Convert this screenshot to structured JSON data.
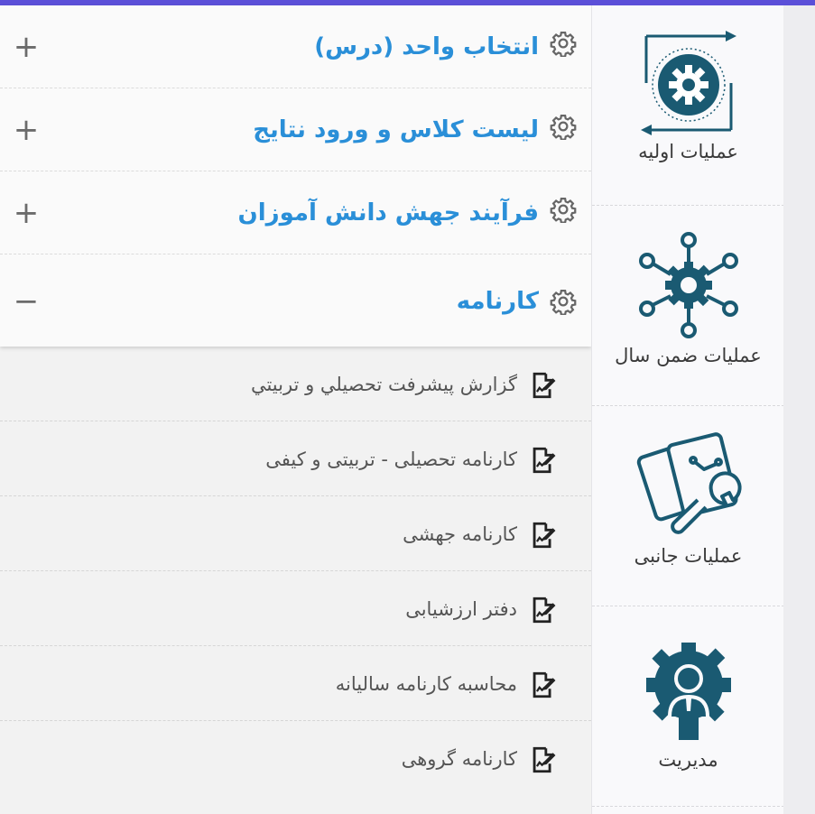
{
  "colors": {
    "accent": "#2a8fd8",
    "icon_teal": "#1a5a72",
    "topbar": "#5b4fd8"
  },
  "sidebar": {
    "items": [
      {
        "label": "عملیات اولیه",
        "icon": "gear-cycle-icon"
      },
      {
        "label": "عملیات ضمن سال",
        "icon": "gear-network-icon"
      },
      {
        "label": "عملیات جانبی",
        "icon": "wrench-cards-icon"
      },
      {
        "label": "مدیریت",
        "icon": "manager-gear-icon"
      }
    ]
  },
  "accordion": {
    "sections": [
      {
        "title": "انتخاب واحد (درس)",
        "toggle": "+"
      },
      {
        "title": "لیست کلاس و ورود نتایج",
        "toggle": "+"
      },
      {
        "title": "فرآیند جهش دانش آموزان",
        "toggle": "+"
      },
      {
        "title": "کارنامه",
        "toggle": "−"
      }
    ],
    "report_items": [
      "گزارش پیشرفت تحصيلي و تربيتي",
      "کارنامه تحصیلی - تربیتی و کیفی",
      "کارنامه جهشی",
      "دفتر ارزشیابی",
      "محاسبه کارنامه سالیانه",
      "کارنامه گروهی"
    ]
  }
}
